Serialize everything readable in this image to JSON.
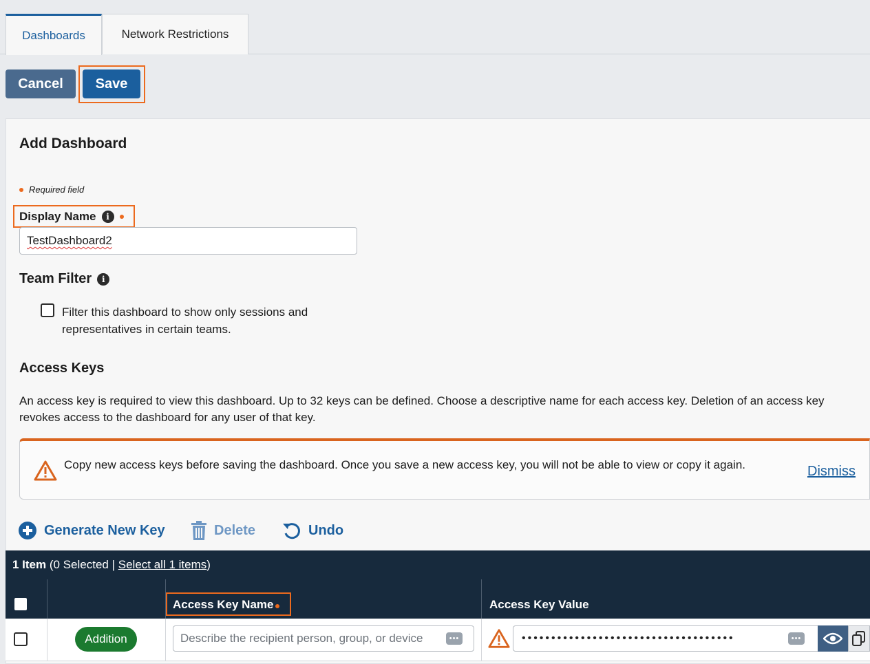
{
  "tabs": [
    {
      "label": "Dashboards",
      "active": true
    },
    {
      "label": "Network Restrictions",
      "active": false
    }
  ],
  "toolbar": {
    "cancel_label": "Cancel",
    "save_label": "Save"
  },
  "form": {
    "title": "Add Dashboard",
    "required_note": "Required field",
    "display_name": {
      "label": "Display Name",
      "value": "TestDashboard2"
    },
    "team_filter": {
      "label": "Team Filter",
      "checkbox_label": "Filter this dashboard to show only sessions and representatives in certain teams.",
      "checked": false
    }
  },
  "access_keys": {
    "title": "Access Keys",
    "description": "An access key is required to view this dashboard. Up to 32 keys can be defined. Choose a descriptive name for each access key. Deletion of an access key revokes access to the dashboard for any user of that key.",
    "alert": {
      "text": "Copy new access keys before saving the dashboard. Once you save a new access key, you will not be able to view or copy it again.",
      "dismiss_label": "Dismiss"
    },
    "actions": {
      "generate": "Generate New Key",
      "delete": "Delete",
      "undo": "Undo"
    },
    "grid": {
      "count_label": "1 Item",
      "selected_label": "(0 Selected",
      "select_all_label": "Select all 1 items",
      "close_paren": ")",
      "columns": [
        "Access Key Name",
        "Access Key Value"
      ],
      "rows": [
        {
          "status": "Addition",
          "name_placeholder": "Describe the recipient person, group, or device",
          "value_masked": "••••••••••••••••••••••••••••••••••••"
        }
      ]
    }
  },
  "colors": {
    "accent": "#1b5f9e",
    "highlight": "#ec6a1e",
    "grid_header": "#172a3d",
    "badge_green": "#1b7a2f",
    "warning": "#d9641e"
  }
}
